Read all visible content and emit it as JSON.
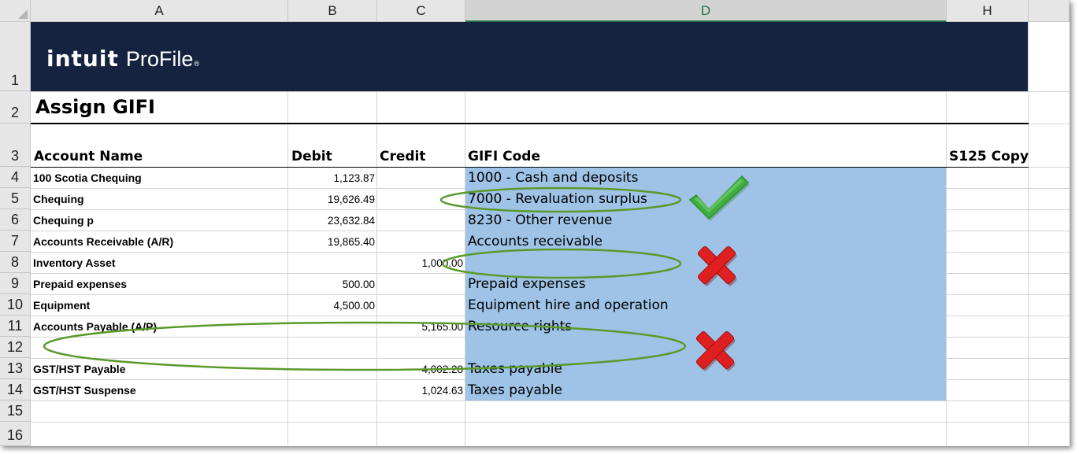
{
  "columns": [
    "A",
    "B",
    "C",
    "D",
    "H"
  ],
  "selected_column": "D",
  "rows": [
    "1",
    "2",
    "3",
    "4",
    "5",
    "6",
    "7",
    "8",
    "9",
    "10",
    "11",
    "12",
    "13",
    "14",
    "15",
    "16"
  ],
  "banner": {
    "brand": "intuit",
    "product": "ProFile",
    "registered": "®"
  },
  "title": "Assign GIFI",
  "headers": {
    "account_name": "Account Name",
    "debit": "Debit",
    "credit": "Credit",
    "gifi_code": "GIFI Code",
    "s125_copy": "S125 Copy"
  },
  "data_rows": [
    {
      "account": "100 Scotia Chequing",
      "debit": "1,123.87",
      "credit": "",
      "gifi": "1000 - Cash and deposits"
    },
    {
      "account": "Chequing",
      "debit": "19,626.49",
      "credit": "",
      "gifi": "7000 - Revaluation surplus"
    },
    {
      "account": "Chequing p",
      "debit": "23,632.84",
      "credit": "",
      "gifi": "8230 - Other revenue"
    },
    {
      "account": "Accounts Receivable (A/R)",
      "debit": "19,865.40",
      "credit": "",
      "gifi": "Accounts receivable"
    },
    {
      "account": "Inventory Asset",
      "debit": "",
      "credit": "1,000.00",
      "gifi": ""
    },
    {
      "account": "Prepaid expenses",
      "debit": "500.00",
      "credit": "",
      "gifi": "Prepaid expenses"
    },
    {
      "account": "Equipment",
      "debit": "4,500.00",
      "credit": "",
      "gifi": "Equipment hire and operation"
    },
    {
      "account": "Accounts Payable (A/P)",
      "debit": "",
      "credit": "5,165.00",
      "gifi": "Resource rights"
    },
    {
      "account": "",
      "debit": "",
      "credit": "",
      "gifi": ""
    },
    {
      "account": "GST/HST Payable",
      "debit": "",
      "credit": "4,002.28",
      "gifi": "Taxes payable"
    },
    {
      "account": "GST/HST Suspense",
      "debit": "",
      "credit": "1,024.63",
      "gifi": "Taxes payable"
    }
  ],
  "annotations": {
    "checkmark_icon": "green-checkmark-icon",
    "cross_icon": "red-x-icon",
    "accent_green": "#5a9a2a",
    "check_green": "#3fae3f",
    "cross_red": "#e02020",
    "banner_navy": "#162340",
    "highlight_blue": "#9ec3e6"
  }
}
